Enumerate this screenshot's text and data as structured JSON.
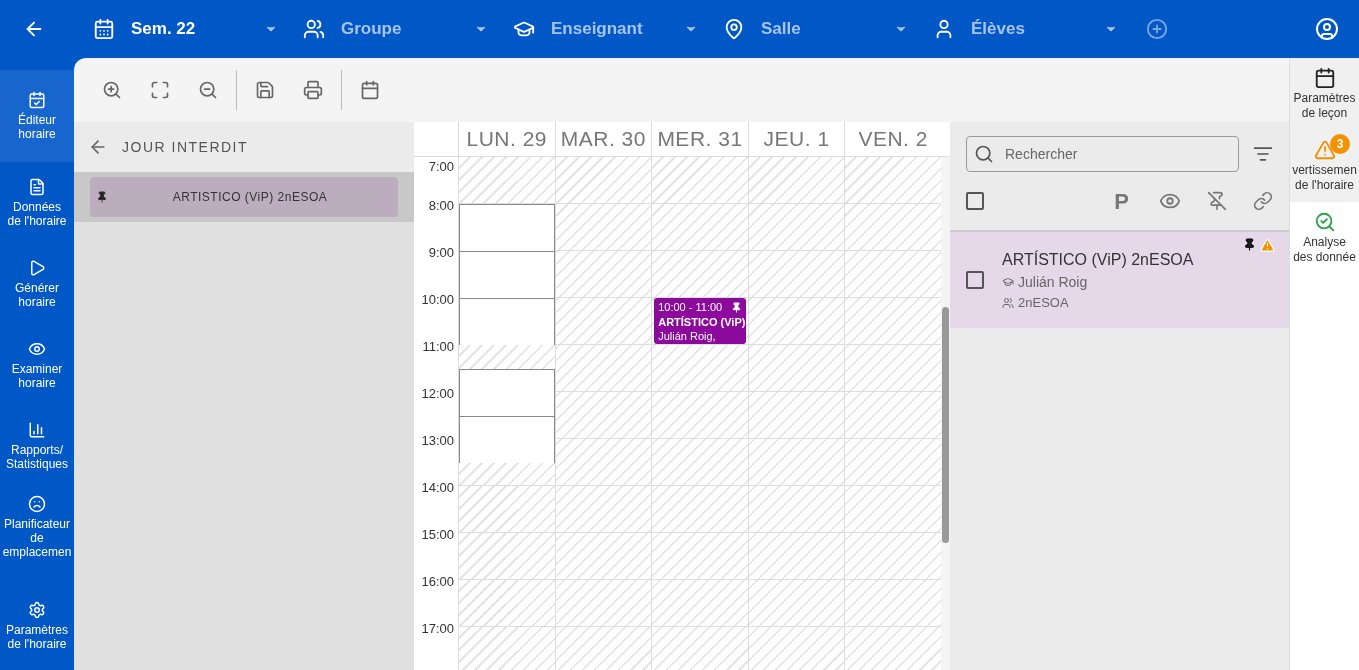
{
  "top_bar": {
    "selectors": [
      {
        "value": "Sem. 22"
      },
      {
        "placeholder": "Groupe"
      },
      {
        "placeholder": "Enseignant"
      },
      {
        "placeholder": "Salle"
      },
      {
        "placeholder": "Élèves"
      }
    ]
  },
  "sidebar": {
    "items": [
      {
        "lines": [
          "Éditeur",
          "horaire"
        ],
        "selected": true
      },
      {
        "lines": [
          "Données",
          "de l'horaire"
        ],
        "selected": false
      },
      {
        "lines": [
          "Générer",
          "horaire"
        ],
        "selected": false
      },
      {
        "lines": [
          "Examiner",
          "horaire"
        ],
        "selected": false
      },
      {
        "lines": [
          "Rapports/",
          "Statistiques"
        ],
        "selected": false
      },
      {
        "lines": [
          "Planificateur",
          "de",
          "emplacemen"
        ],
        "selected": false
      },
      {
        "lines": [
          "Paramètres",
          "de l'horaire"
        ],
        "selected": false
      }
    ]
  },
  "forbidden_day_panel": {
    "title": "JOUR INTERDIT",
    "items": [
      {
        "label": "ARTISTICO (ViP) 2nESOA",
        "pinned": true,
        "selected": true
      }
    ]
  },
  "calendar": {
    "hours": [
      "7:00",
      "8:00",
      "9:00",
      "10:00",
      "11:00",
      "12:00",
      "13:00",
      "14:00",
      "15:00",
      "16:00",
      "17:00"
    ],
    "days": [
      {
        "label": "LUN. 29",
        "half_hour_available": [
          false,
          false,
          true,
          true,
          true,
          true,
          true,
          true,
          false,
          true,
          true,
          true,
          true,
          false,
          false,
          false,
          false,
          false,
          false,
          false,
          false,
          false
        ]
      },
      {
        "label": "MAR. 30"
      },
      {
        "label": "MER. 31",
        "events": [
          {
            "time": "10:00 - 11:00",
            "title": "ARTÍSTICO (ViP)",
            "teacher": "Julián Roig,",
            "pinned": true,
            "color": "#8b0a9b"
          }
        ]
      },
      {
        "label": "JEU. 1"
      },
      {
        "label": "VEN. 2"
      }
    ]
  },
  "lessons_panel": {
    "search": {
      "placeholder": "Rechercher"
    },
    "select_all": {
      "checked": false
    },
    "column_p": "P",
    "lessons": [
      {
        "title": "ARTÍSTICO (ViP) 2nESOA",
        "teacher": "Julián Roig",
        "group": "2nESOA",
        "checked": false,
        "selected": true,
        "pinned": true,
        "warning": true
      }
    ]
  },
  "right_rail": {
    "items": [
      {
        "lines": [
          "Paramètres",
          "de leçon"
        ],
        "selected": false
      },
      {
        "lines": [
          "vertissemen",
          "de l'horaire"
        ],
        "badge": "3",
        "selected": false
      },
      {
        "lines": [
          "Analyse",
          "des donnée"
        ],
        "selected": true
      }
    ]
  }
}
